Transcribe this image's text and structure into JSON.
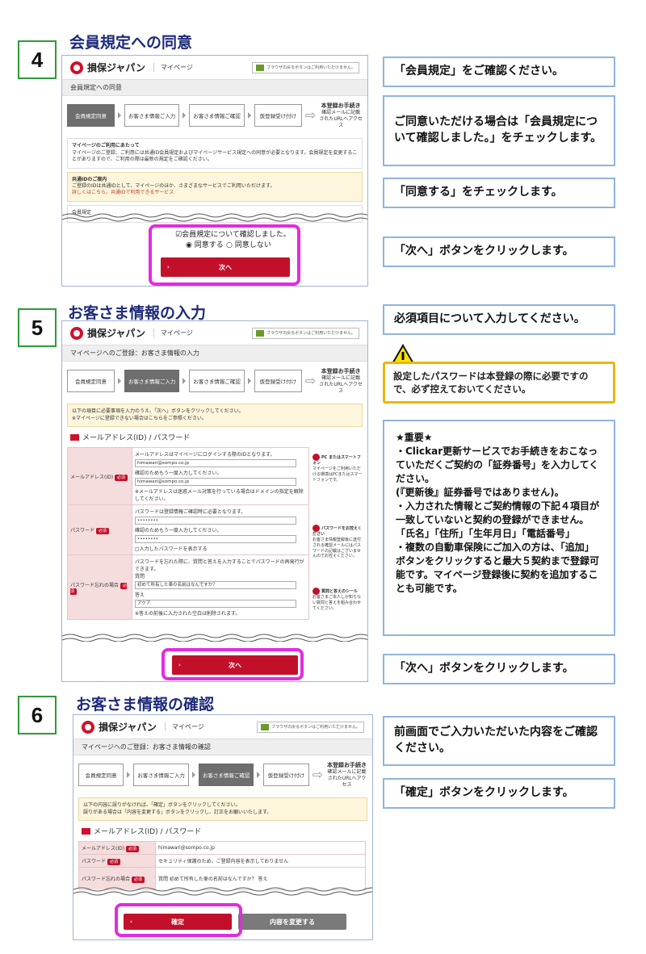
{
  "sections": [
    {
      "number": "4",
      "title": "会員規定への同意"
    },
    {
      "number": "5",
      "title": "お客さま情報の入力"
    },
    {
      "number": "6",
      "title": "お客さま情報の確認"
    }
  ],
  "mini": {
    "brand": "損保ジャパン",
    "mypage": "マイページ",
    "badge": "ブラウザの戻るボタンはご利用いただけません。",
    "steps": [
      "会員規定同意",
      "お客さま情報ご入力",
      "お客さま情報ご確認",
      "仮登録受け付け"
    ],
    "last_step_title": "本登録お手続き",
    "last_step_sub": "確認メールに記載されたURLへアクセス",
    "s4": {
      "bar": "会員規定への同意",
      "box1_title": "マイページのご利用にあたって",
      "box1_text": "マイページのご登録、ご利用には共通ID会員規定およびマイページサービス規定への同意が必要となります。会員規定を変更することがありますので、ご利用の際は最新の規定をご確認ください。",
      "box2_title": "共通IDのご案内",
      "box2_text": "ご登録のIDは共通IDとして、マイページのほか、さまざまなサービスでご利用いただけます。",
      "box2_link": "詳しくはこちら。共通IDで利用できるサービス",
      "rules_label": "会員規定",
      "check_label": "☑会員規定について確認しました。",
      "agree": "◉ 同意する",
      "disagree": "○ 同意しない",
      "next": "次へ"
    },
    "s5": {
      "bar": "マイページへのご登録：お客さま情報の入力",
      "notice1": "以下の項目に必要事項を入力のうえ、「次へ」ボタンをクリックしてください。",
      "notice2": "※マイページに登録できない場合はこちらをご参照ください。",
      "section": "メールアドレス(ID) / パスワード",
      "rows": [
        {
          "label": "メールアドレス(ID)",
          "desc": "メールアドレスはマイページにログインする際のIDとなります。",
          "v1": "himawari@sompo.co.jp",
          "confirm": "確認のためもう一度入力してください。",
          "v2": "himawari@sompo.co.jp",
          "note": "※メールアドレスは迷惑メール対策を行っている場合はドメインの指定を解除してください。"
        },
        {
          "label": "パスワード",
          "desc": "パスワードは登録情報ご確認時に必要となります。",
          "v1": "••••••••",
          "confirm": "確認のためもう一度入力してください。",
          "v2": "••••••••",
          "note": "□入力したパスワードを表示する"
        },
        {
          "label": "パスワード忘れの場合",
          "desc": "パスワードを忘れた際に、質問と答えを入力することでパスワードの再発行ができます。",
          "q_label": "質問",
          "q_value": "初めて所有した車の名前はなんですか？",
          "a_label": "答え",
          "a_value": "アクア",
          "note": "※答えの前後に入力された空白は削除されます。"
        }
      ],
      "side1_title": "PC またはスマートフォン",
      "side1_text": "マイページをご利用いただける環境はPCまたはスマートフォンです。",
      "side2_title": "パスワードをお控えください",
      "side2_text": "お客さま情報登録後に送付される確認メールにはパスワードの記載はございませんのでお控えください。",
      "side3_title": "質問と答えのシール",
      "side3_text": "お客さまご本人しか知らない質問と答えを組み合わせてください。",
      "next": "次へ"
    },
    "s6": {
      "bar": "マイページへのご登録：お客さま情報の確認",
      "notice1": "以下の内容に誤りがなければ、「確定」ボタンをクリックしてください。",
      "notice2": "誤りがある場合は「内容を変更する」ボタンをクリックし、訂正をお願いいたします。",
      "section": "メールアドレス(ID) / パスワード",
      "rows": [
        {
          "label": "メールアドレス(ID)",
          "value": "himawari@sompo.co.jp"
        },
        {
          "label": "パスワード",
          "value": "セキュリティ保護のため、ご登録内容を表示しておりません"
        },
        {
          "label": "パスワード忘れの場合",
          "value": "質問 初めて所有した車の名前はなんですか？ 答え"
        }
      ],
      "confirm": "確定",
      "change": "内容を変更する"
    }
  },
  "callouts": {
    "c4a": "「会員規定」をご確認ください。",
    "c4b": "ご同意いただける場合は「会員規定について確認しました。」をチェックします。",
    "c4c": "「同意する」をチェックします。",
    "c4d": "「次へ」ボタンをクリックします。",
    "c5a": "必須項目について入力してください。",
    "c5warn": "設定したパスワードは本登録の際に必要ですので、必ず控えておいてください。",
    "c5note": "★重要★\n・Clickar更新サービスでお手続きをおこなっていただくご契約の「証券番号」を入力してください。\n(『更新後』証券番号ではありません)。\n・入力された情報とご契約情報の下記４項目が一致していないと契約の登録ができません。\n「氏名」「住所」「生年月日」「電話番号」\n・複数の自動車保険にご加入の方は、「追加」ボタンをクリックすると最大５契約まで登録可能です。マイページ登録後に契約を追加することも可能です。",
    "c5b": "「次へ」ボタンをクリックします。",
    "c6a": "前画面でご入力いただいた内容をご確認ください。",
    "c6b": "「確定」ボタンをクリックします。"
  }
}
